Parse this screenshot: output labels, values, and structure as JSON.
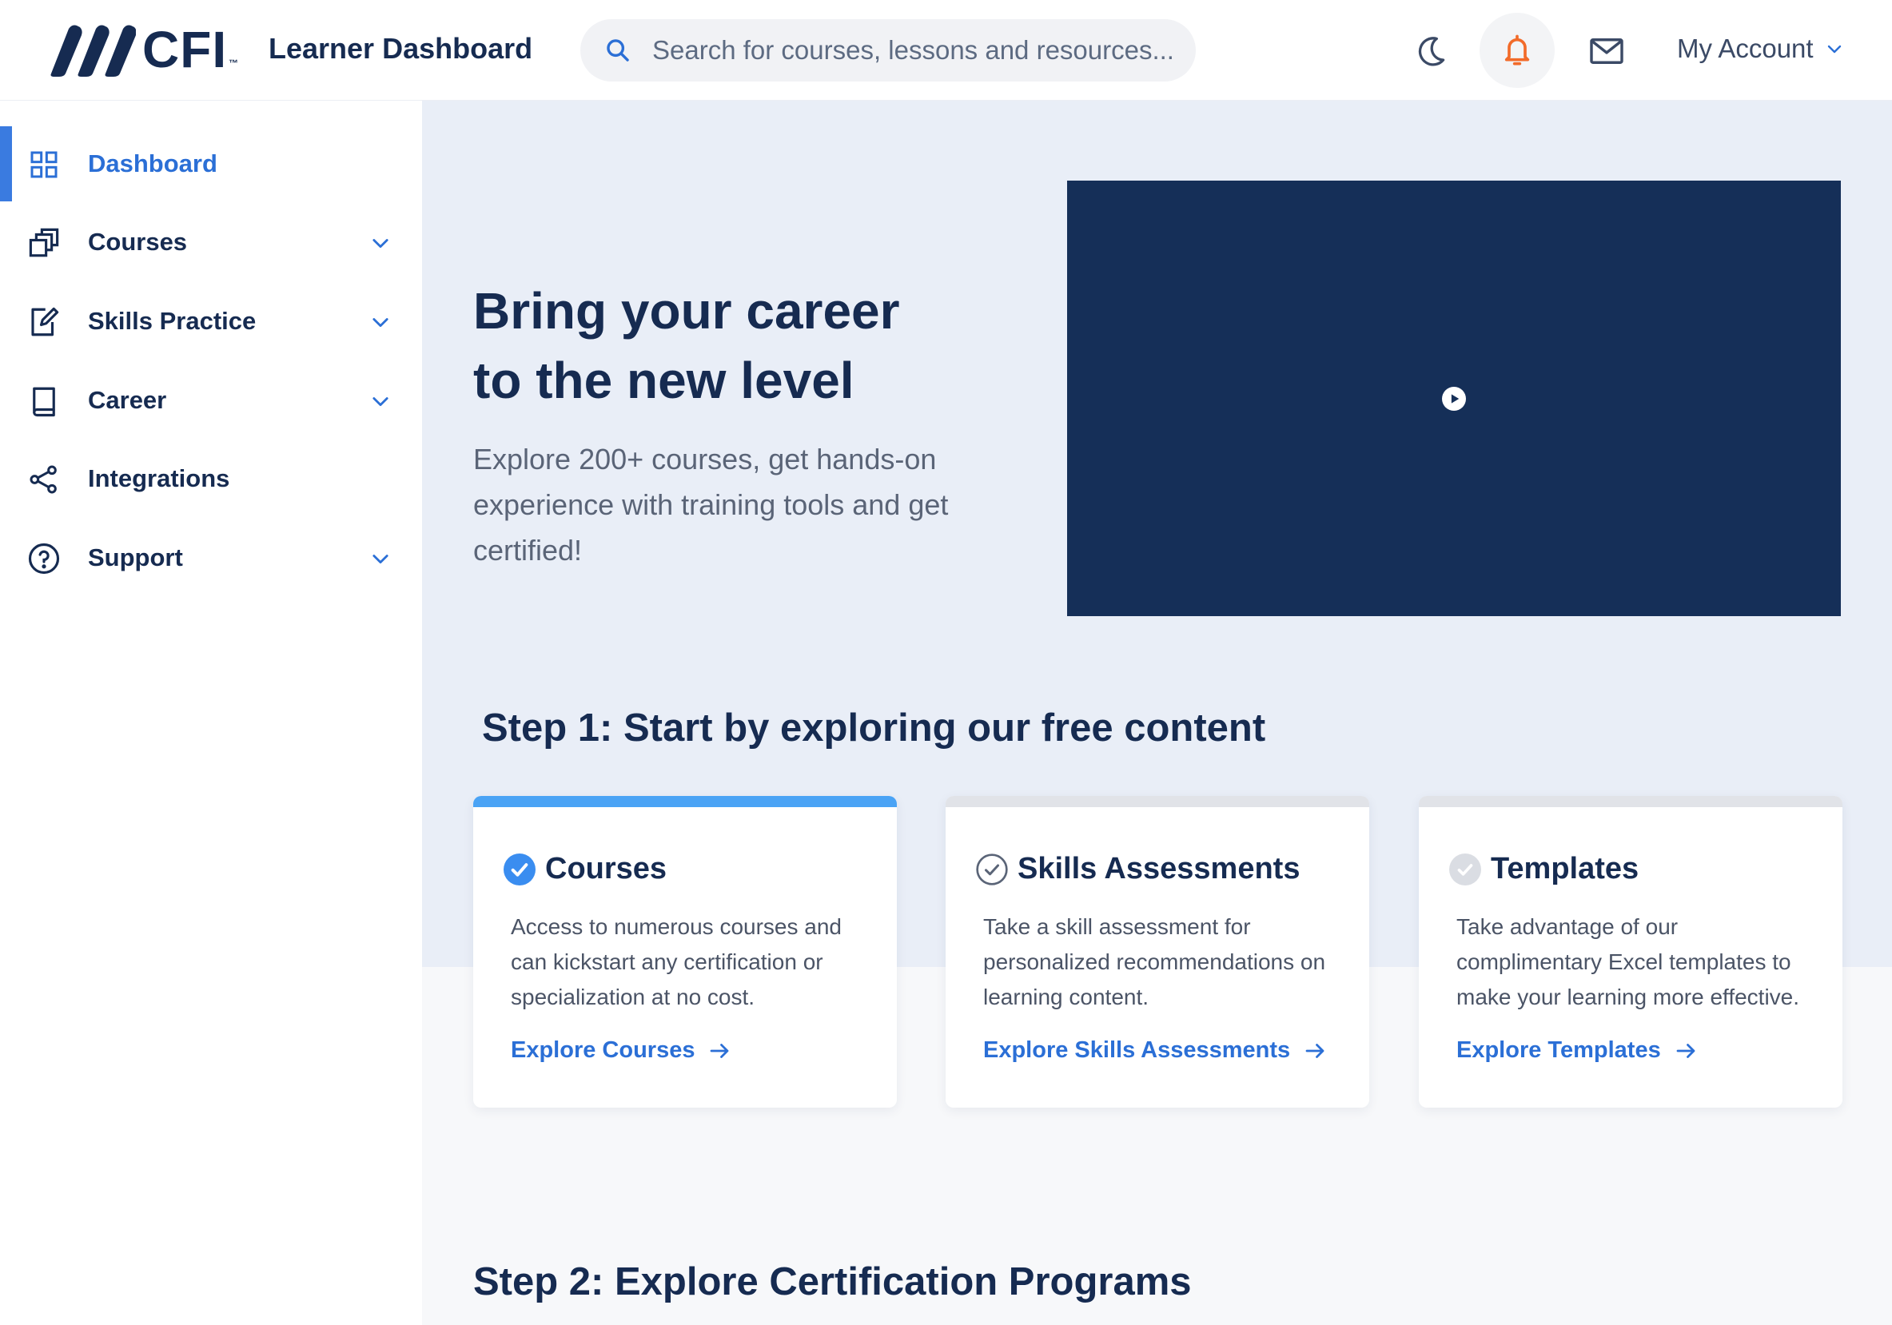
{
  "header": {
    "logo_text": "CFI",
    "logo_tm": "™",
    "app_title": "Learner Dashboard",
    "search_placeholder": "Search for courses, lessons and resources...",
    "account_label": "My Account"
  },
  "sidebar": {
    "items": [
      {
        "label": "Dashboard",
        "icon": "grid-icon",
        "active": true,
        "expandable": false
      },
      {
        "label": "Courses",
        "icon": "stacked-squares-icon",
        "expandable": true
      },
      {
        "label": "Skills Practice",
        "icon": "edit-note-icon",
        "expandable": true
      },
      {
        "label": "Career",
        "icon": "book-icon",
        "expandable": true
      },
      {
        "label": "Integrations",
        "icon": "share-nodes-icon",
        "expandable": false
      },
      {
        "label": "Support",
        "icon": "question-circle-icon",
        "expandable": true
      }
    ]
  },
  "hero": {
    "title_line1": "Bring your career",
    "title_line2": "to the new level",
    "subtitle": "Explore 200+ courses, get hands-on experience with training tools and get certified!"
  },
  "step1": {
    "heading": "Step 1: Start by exploring our free content",
    "cards": [
      {
        "title": "Courses",
        "description": "Access to numerous courses and can kickstart any certification or specialization at no cost.",
        "link": "Explore Courses",
        "state": "active"
      },
      {
        "title": "Skills Assessments",
        "description": "Take a skill assessment for personalized recommendations on learning content.",
        "link": "Explore Skills Assessments",
        "state": "outlined"
      },
      {
        "title": "Templates",
        "description": "Take advantage of our complimentary Excel templates to make your learning more effective.",
        "link": "Explore Templates",
        "state": "inactive"
      }
    ]
  },
  "step2": {
    "heading": "Step 2: Explore Certification Programs"
  },
  "colors": {
    "navy": "#162b51",
    "accent_blue": "#2b6fd6",
    "active_bar": "#3a7be0",
    "card_active_bar": "#4aa3f5",
    "bell_orange": "#f26b2a",
    "video_bg": "#152f58",
    "hero_bg": "#e9eef7"
  }
}
